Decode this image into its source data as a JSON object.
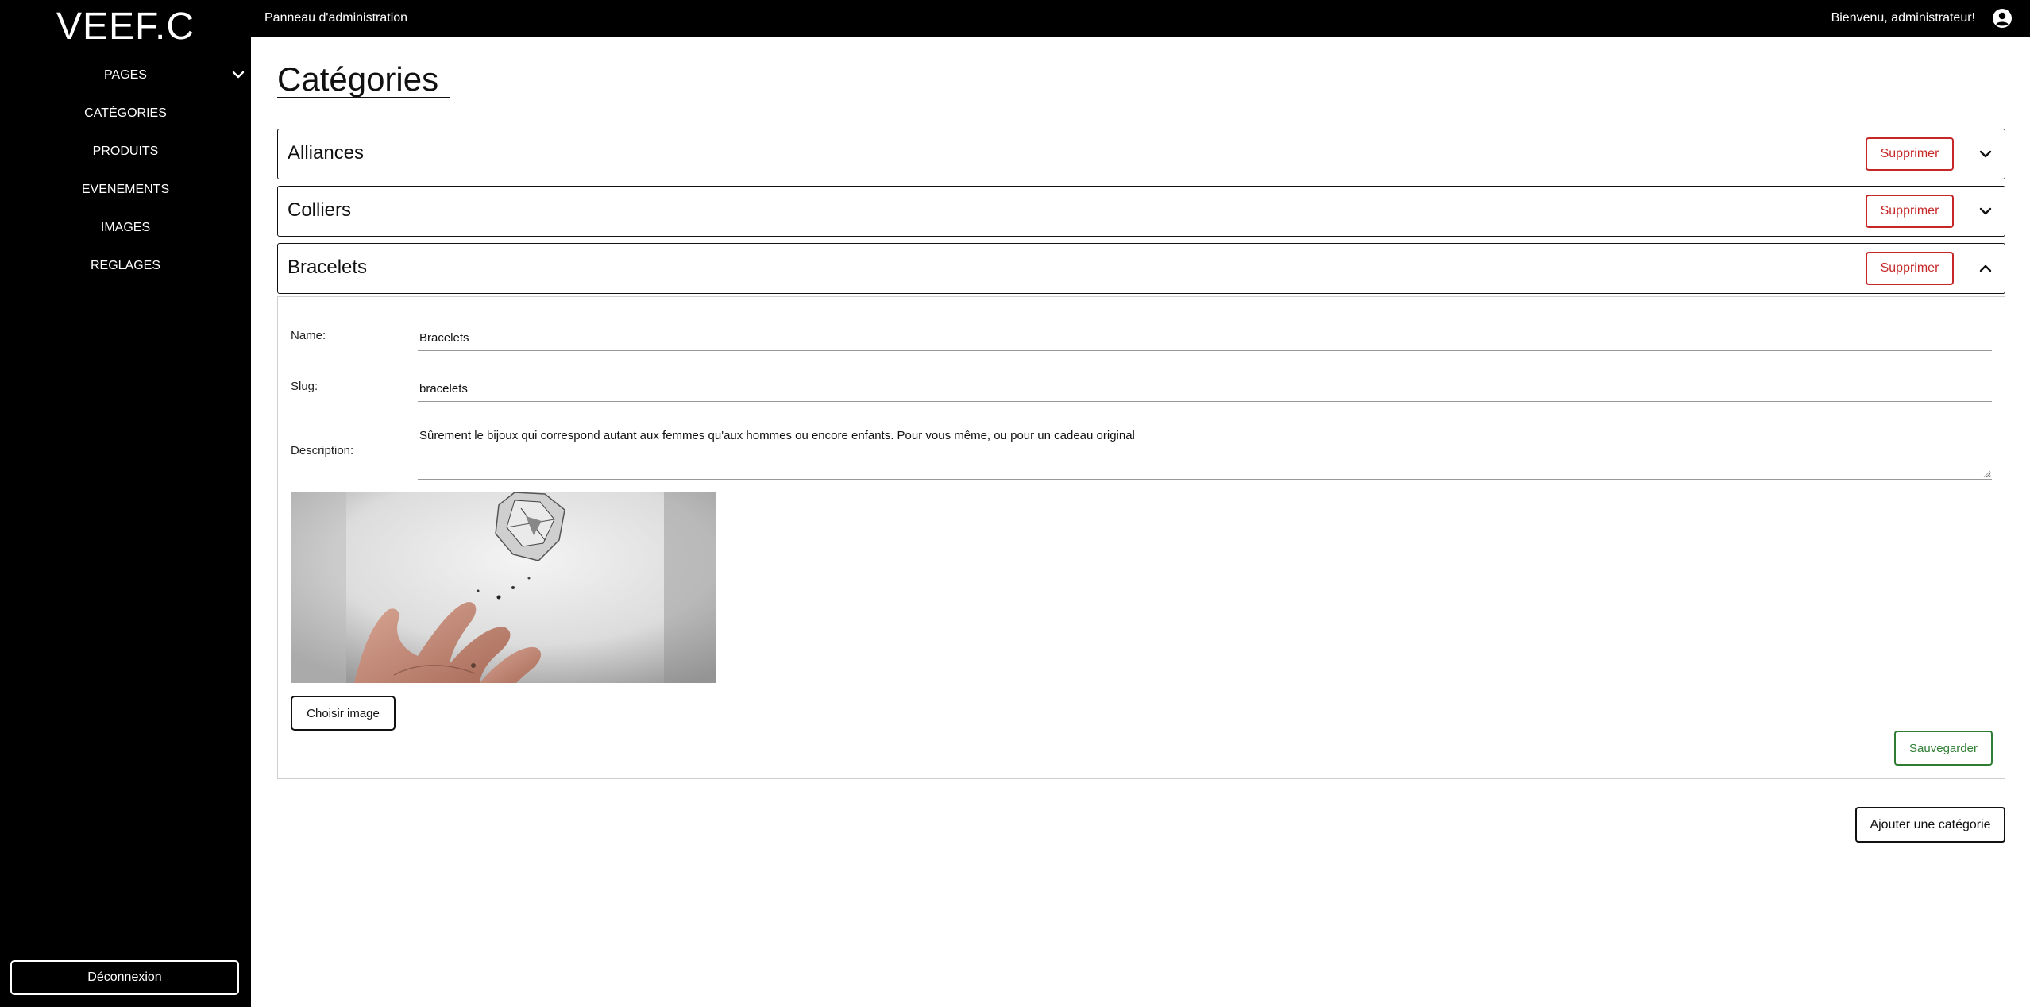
{
  "sidebar": {
    "logo": "VEEF.C",
    "items": [
      {
        "label": "PAGES"
      },
      {
        "label": "CATÉGORIES"
      },
      {
        "label": "PRODUITS"
      },
      {
        "label": "EVENEMENTS"
      },
      {
        "label": "IMAGES"
      },
      {
        "label": "REGLAGES"
      }
    ],
    "logout_label": "Déconnexion"
  },
  "topbar": {
    "title": "Panneau d'administration",
    "welcome": "Bienvenu, administrateur!",
    "user_icon": "user-circle-icon"
  },
  "main": {
    "page_title": "Catégories",
    "categories": [
      {
        "name": "Alliances",
        "delete_label": "Supprimer",
        "expanded": false
      },
      {
        "name": "Colliers",
        "delete_label": "Supprimer",
        "expanded": false
      },
      {
        "name": "Bracelets",
        "delete_label": "Supprimer",
        "expanded": true
      }
    ],
    "edit_form": {
      "name_label": "Name:",
      "name_value": "Bracelets",
      "slug_label": "Slug:",
      "slug_value": "bracelets",
      "description_label": "Description:",
      "description_value": "Sûrement le bijoux qui correspond autant aux femmes qu'aux hommes ou encore enfants. Pour vous même, ou pour un cadeau original",
      "choose_image_label": "Choisir image",
      "save_label": "Sauvegarder"
    },
    "add_category_label": "Ajouter une catégorie"
  },
  "colors": {
    "sidebar_bg": "#000000",
    "delete_accent": "#c62828",
    "save_accent": "#2e7d32"
  }
}
